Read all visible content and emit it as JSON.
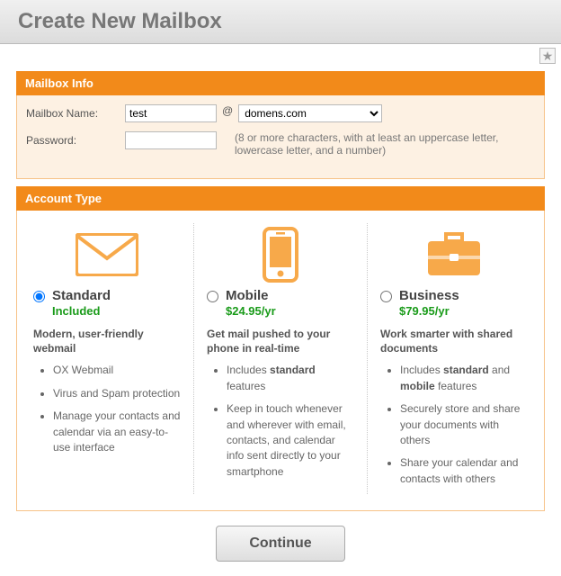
{
  "page": {
    "title": "Create New Mailbox"
  },
  "mailboxInfo": {
    "header": "Mailbox Info",
    "nameLabel": "Mailbox Name:",
    "nameValue": "test",
    "at": "@",
    "domain": "domens.com",
    "passwordLabel": "Password:",
    "passwordValue": "",
    "passwordHint": "(8 or more characters, with at least an uppercase letter, lowercase letter, and a number)"
  },
  "accountType": {
    "header": "Account Type",
    "plans": [
      {
        "id": "standard",
        "name": "Standard",
        "price": "Included",
        "selected": true,
        "tagline": "Modern, user-friendly webmail",
        "features": [
          "OX Webmail",
          "Virus and Spam protection",
          "Manage your contacts and calendar via an easy-to-use interface"
        ]
      },
      {
        "id": "mobile",
        "name": "Mobile",
        "price": "$24.95/yr",
        "selected": false,
        "tagline": "Get mail pushed to your phone in real-time",
        "features_html": [
          "Includes <b>standard</b> features",
          "Keep in touch whenever and wherever with email, contacts, and calendar info sent directly to your smartphone"
        ]
      },
      {
        "id": "business",
        "name": "Business",
        "price": "$79.95/yr",
        "selected": false,
        "tagline": "Work smarter with shared documents",
        "features_html": [
          "Includes <b>standard</b> and <b>mobile</b> features",
          "Securely store and share your documents with others",
          "Share your calendar and contacts with others"
        ]
      }
    ]
  },
  "actions": {
    "continue": "Continue"
  }
}
